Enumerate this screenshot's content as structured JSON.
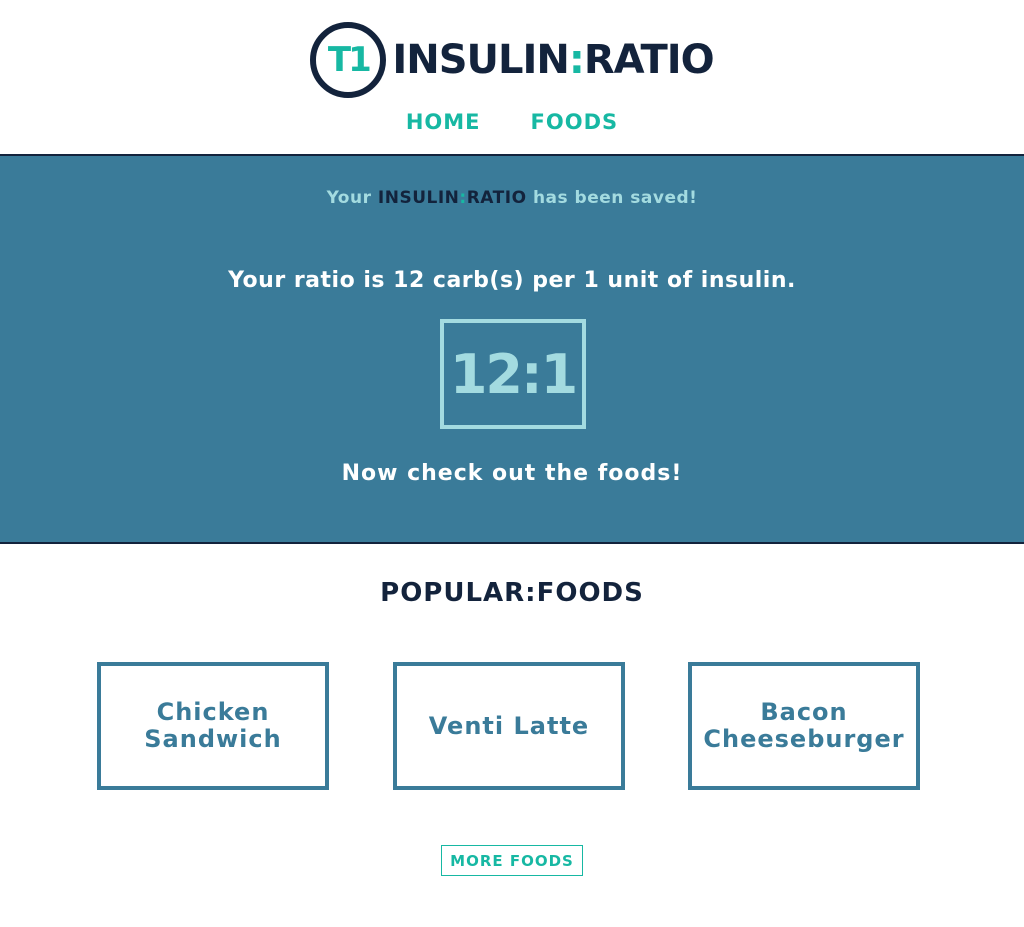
{
  "header": {
    "logo_badge": "T1",
    "logo_word1": "INSULIN",
    "logo_colon": ":",
    "logo_word2": "RATIO",
    "nav": [
      {
        "label": "HOME"
      },
      {
        "label": "FOODS"
      }
    ]
  },
  "hero": {
    "saved_prefix": "Your ",
    "saved_brand1": "INSULIN",
    "saved_brand_colon": ":",
    "saved_brand2": "RATIO",
    "saved_suffix": " has been saved!",
    "ratio_sentence": "Your ratio is 12 carb(s) per 1 unit of insulin.",
    "ratio_value": "12:1",
    "cta_text": "Now check out the foods!"
  },
  "popular": {
    "title": "POPULAR:FOODS",
    "foods": [
      {
        "name": "Chicken Sandwich"
      },
      {
        "name": "Venti Latte"
      },
      {
        "name": "Bacon Cheeseburger"
      }
    ],
    "more_label": "MORE FOODS"
  },
  "colors": {
    "navy": "#13233c",
    "teal": "#17b8a3",
    "hero_bg": "#3a7b99",
    "light_aqua": "#a3dbe0"
  }
}
